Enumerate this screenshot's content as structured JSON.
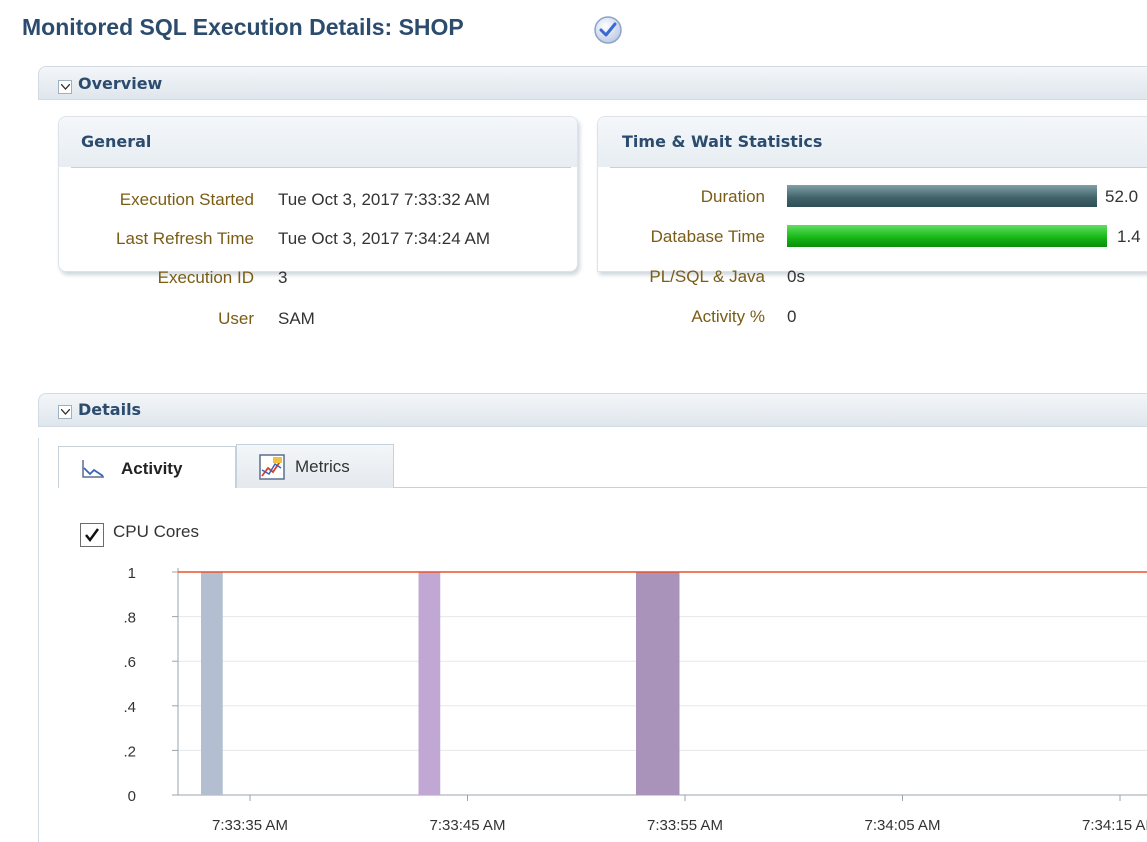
{
  "page": {
    "title": "Monitored SQL Execution Details: SHOP",
    "status_icon": "check-circle-icon"
  },
  "overview": {
    "label": "Overview",
    "general": {
      "title": "General",
      "rows": [
        {
          "label": "Execution Started",
          "value": "Tue Oct 3, 2017 7:33:32 AM"
        },
        {
          "label": "Last Refresh Time",
          "value": "Tue Oct 3, 2017 7:34:24 AM"
        },
        {
          "label": "Execution ID",
          "value": "3"
        },
        {
          "label": "User",
          "value": "SAM"
        }
      ]
    },
    "time_wait": {
      "title": "Time & Wait Statistics",
      "rows": [
        {
          "label": "Duration",
          "value": "52.0"
        },
        {
          "label": "Database Time",
          "value": "1.4"
        },
        {
          "label": "PL/SQL & Java",
          "value": "0s"
        },
        {
          "label": "Activity %",
          "value": "0"
        }
      ],
      "colors": {
        "duration_bar": "#3e6167",
        "database_time_bar": "#14b414"
      }
    }
  },
  "details": {
    "label": "Details",
    "tabs": [
      {
        "label": "Activity",
        "icon": "activity-chart-icon",
        "selected": true
      },
      {
        "label": "Metrics",
        "icon": "metrics-chart-icon",
        "selected": false
      }
    ],
    "cpu_cores": {
      "label": "CPU Cores",
      "checked": true
    }
  },
  "chart_data": {
    "type": "bar",
    "title": "",
    "xlabel": "",
    "ylabel": "",
    "ylim": [
      0,
      1
    ],
    "y_ticks": [
      "0",
      ".2",
      ".4",
      ".6",
      ".8",
      "1"
    ],
    "x_ticks": [
      "7:33:35 AM",
      "7:33:45 AM",
      "7:33:55 AM",
      "7:34:05 AM",
      "7:34:15 AM"
    ],
    "cpu_cores_line": 1,
    "cpu_line_color": "#e8542a",
    "bars": [
      {
        "start": 1.0,
        "end": 2.0,
        "value": 1,
        "color": "#b3bfd1"
      },
      {
        "start": 11.0,
        "end": 12.0,
        "value": 1,
        "color": "#c0a7d4"
      },
      {
        "start": 21.0,
        "end": 23.0,
        "value": 1,
        "color": "#a993bb"
      }
    ],
    "x_unit": "seconds after 7:33:35 AM",
    "grid": true
  }
}
